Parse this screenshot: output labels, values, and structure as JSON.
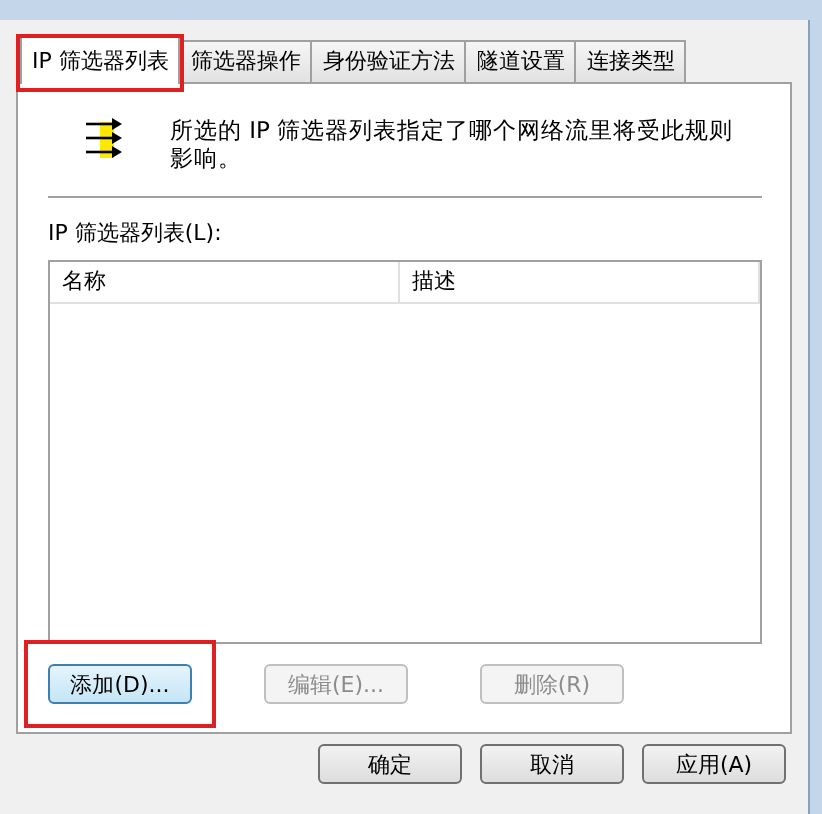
{
  "tabs": [
    {
      "label": "IP 筛选器列表",
      "selected": true,
      "highlighted": true
    },
    {
      "label": "筛选器操作",
      "selected": false,
      "highlighted": false
    },
    {
      "label": "身份验证方法",
      "selected": false,
      "highlighted": false
    },
    {
      "label": "隧道设置",
      "selected": false,
      "highlighted": false
    },
    {
      "label": "连接类型",
      "selected": false,
      "highlighted": false
    }
  ],
  "description": "所选的 IP 筛选器列表指定了哪个网络流里将受此规则影响。",
  "list": {
    "label": "IP 筛选器列表(L):",
    "columns": [
      "名称",
      "描述"
    ]
  },
  "list_buttons": [
    {
      "label": "添加(D)...",
      "disabled": false,
      "focused": true,
      "highlighted": true
    },
    {
      "label": "编辑(E)...",
      "disabled": true,
      "focused": false,
      "highlighted": false
    },
    {
      "label": "删除(R)",
      "disabled": true,
      "focused": false,
      "highlighted": false
    }
  ],
  "dialog_buttons": [
    {
      "label": "确定",
      "disabled": false
    },
    {
      "label": "取消",
      "disabled": false
    },
    {
      "label": "应用(A)",
      "disabled": false
    }
  ]
}
